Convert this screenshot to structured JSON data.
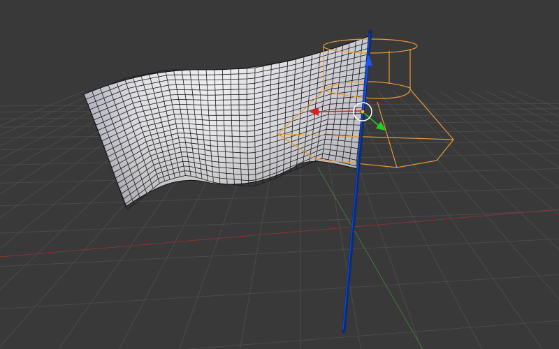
{
  "viewport": {
    "background": "#393939",
    "grid_color": "#4b4b4b",
    "x_axis_color": "#8a3434",
    "y_axis_color": "#3f7a3f"
  },
  "objects": [
    {
      "name": "cloth-flag",
      "type": "subdivided-plane",
      "shading": "solid-white",
      "wireframe": true
    },
    {
      "name": "flag-pole",
      "type": "cylinder",
      "color": "#0a2a7a",
      "selected": false
    },
    {
      "name": "collision-shape",
      "type": "wire-cylinder-cone",
      "color": "#e89a3a",
      "selected": true
    }
  ],
  "gizmo": {
    "type": "translate-manipulator",
    "x_arrow_color": "#dd1f1f",
    "y_arrow_color": "#22cc22",
    "z_arrow_color": "#2255ee",
    "center_color": "#ffffff",
    "pivot_color": "#ffaa33"
  },
  "icons": {
    "translate_gizmo": "move-arrows-icon",
    "pivot": "origin-dot-icon"
  }
}
